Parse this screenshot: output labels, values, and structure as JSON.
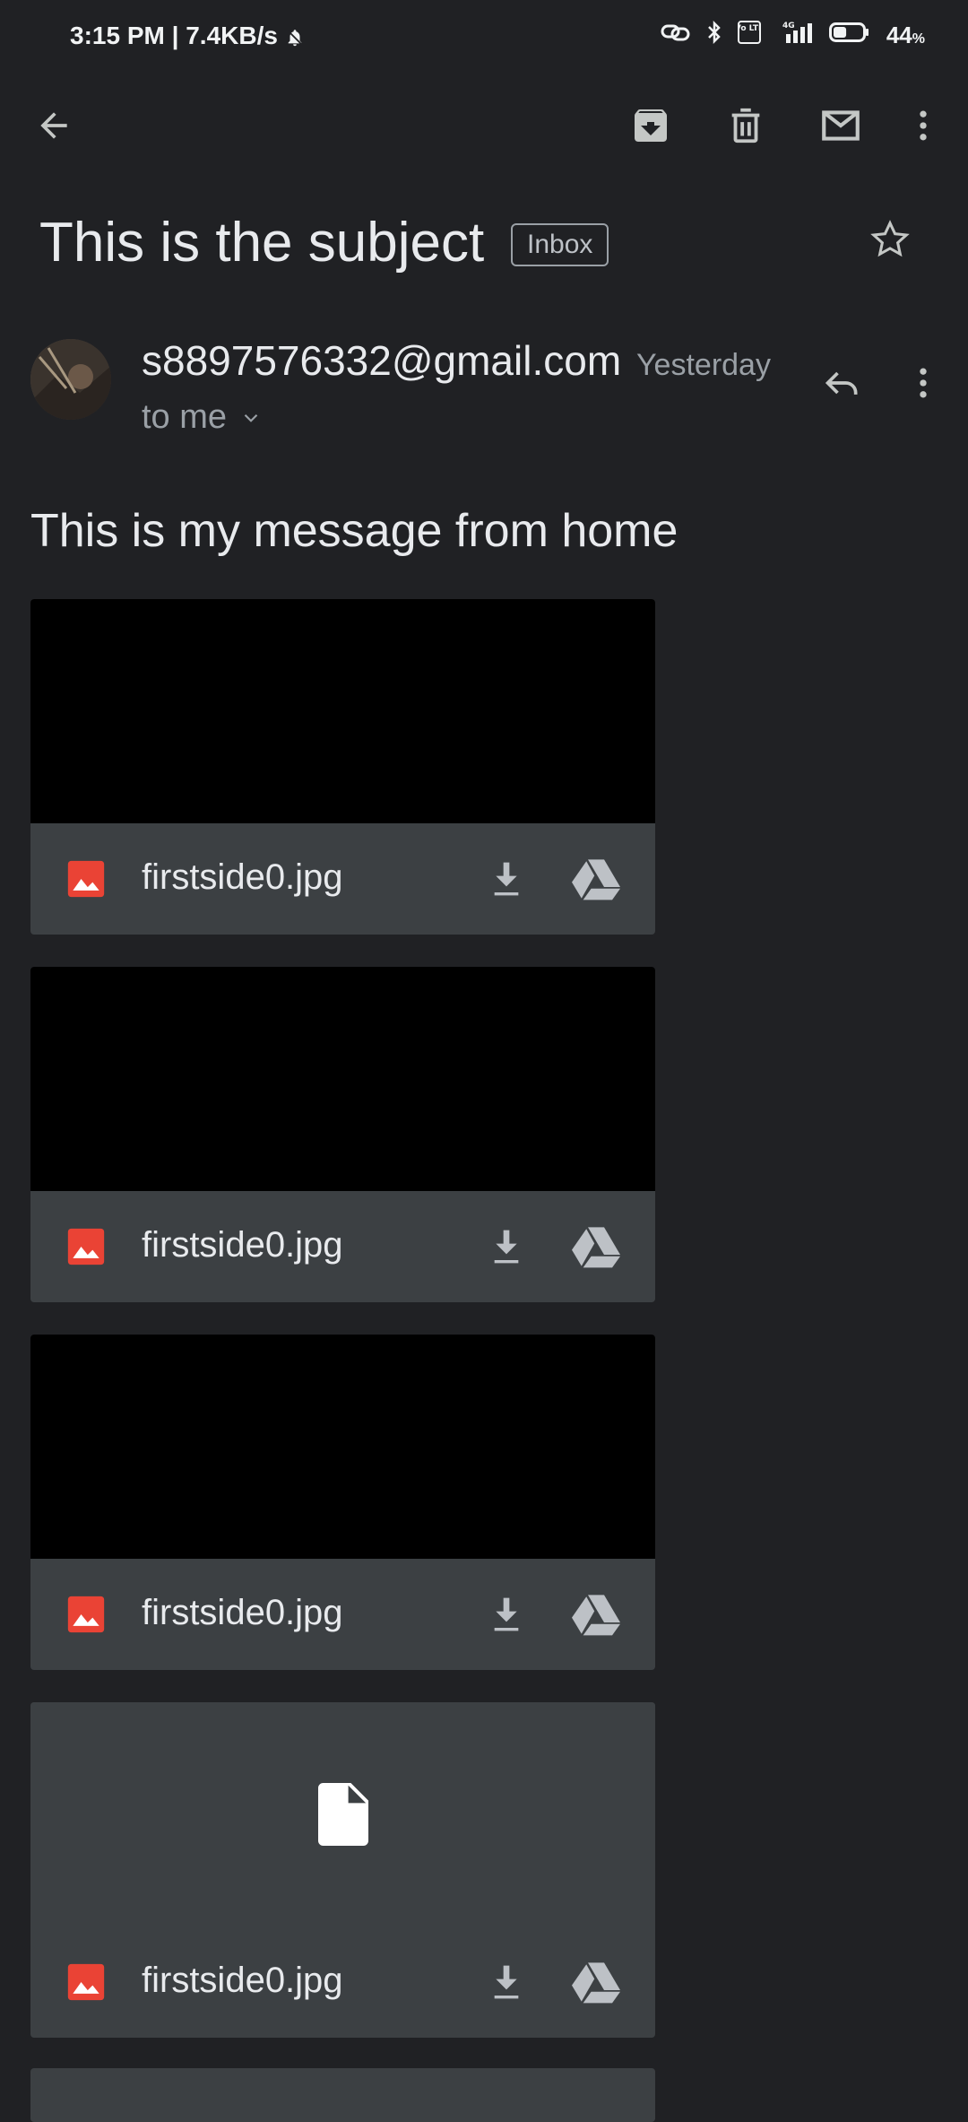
{
  "status_bar": {
    "time_speed": "3:15 PM | 7.4KB/s",
    "network_label": "4G",
    "volte_label": "Vo LTE",
    "battery": "44",
    "battery_unit": "%",
    "battery_level": 0.44
  },
  "toolbar": {
    "back": "back-arrow-icon",
    "archive": "archive-icon",
    "delete": "trash-icon",
    "mark_unread": "mail-icon",
    "more": "more-vert-icon"
  },
  "email": {
    "subject": "This is the subject",
    "label": "Inbox",
    "sender": "s8897576332@gmail.com",
    "time": "Yesterday",
    "recipient": "to me",
    "body": "This is my message from home"
  },
  "attachments": [
    {
      "name": "firstside0.jpg",
      "preview": "image"
    },
    {
      "name": "firstside0.jpg",
      "preview": "image"
    },
    {
      "name": "firstside0.jpg",
      "preview": "image"
    },
    {
      "name": "firstside0.jpg",
      "preview": "document"
    }
  ],
  "colors": {
    "background": "#202124",
    "card": "#3c4043",
    "image_icon": "#ea4335",
    "text_primary": "#e8eaed",
    "text_secondary": "#9aa0a6"
  }
}
